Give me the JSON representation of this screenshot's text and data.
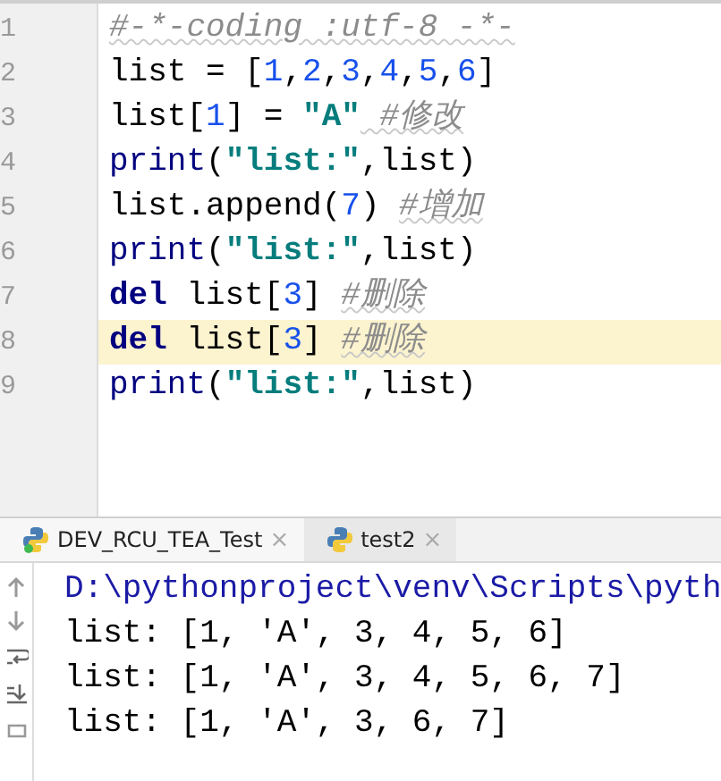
{
  "editor": {
    "lines": [
      {
        "number": "1",
        "current": false,
        "tokens": [
          {
            "kind": "comment",
            "text": "#-*-coding :utf-8 -*-"
          }
        ]
      },
      {
        "number": "2",
        "current": false,
        "tokens": [
          {
            "kind": "plain",
            "text": "list = ["
          },
          {
            "kind": "number",
            "text": "1"
          },
          {
            "kind": "plain",
            "text": ","
          },
          {
            "kind": "number",
            "text": "2"
          },
          {
            "kind": "plain",
            "text": ","
          },
          {
            "kind": "number",
            "text": "3"
          },
          {
            "kind": "plain",
            "text": ","
          },
          {
            "kind": "number",
            "text": "4"
          },
          {
            "kind": "plain",
            "text": ","
          },
          {
            "kind": "number",
            "text": "5"
          },
          {
            "kind": "plain",
            "text": ","
          },
          {
            "kind": "number",
            "text": "6"
          },
          {
            "kind": "plain",
            "text": "]"
          }
        ]
      },
      {
        "number": "3",
        "current": false,
        "tokens": [
          {
            "kind": "plain",
            "text": "list["
          },
          {
            "kind": "number",
            "text": "1"
          },
          {
            "kind": "plain",
            "text": "] = "
          },
          {
            "kind": "string",
            "text": "\"A\""
          },
          {
            "kind": "comment",
            "text": " #修改"
          }
        ]
      },
      {
        "number": "4",
        "current": false,
        "tokens": [
          {
            "kind": "builtin",
            "text": "print"
          },
          {
            "kind": "plain",
            "text": "("
          },
          {
            "kind": "string",
            "text": "\"list:\""
          },
          {
            "kind": "plain",
            "text": ",list)"
          }
        ]
      },
      {
        "number": "5",
        "current": false,
        "tokens": [
          {
            "kind": "plain",
            "text": "list.append("
          },
          {
            "kind": "number",
            "text": "7"
          },
          {
            "kind": "plain",
            "text": ") "
          },
          {
            "kind": "comment",
            "text": "#增加"
          }
        ]
      },
      {
        "number": "6",
        "current": false,
        "tokens": [
          {
            "kind": "builtin",
            "text": "print"
          },
          {
            "kind": "plain",
            "text": "("
          },
          {
            "kind": "string",
            "text": "\"list:\""
          },
          {
            "kind": "plain",
            "text": ",list)"
          }
        ]
      },
      {
        "number": "7",
        "current": false,
        "tokens": [
          {
            "kind": "keyword",
            "text": "del"
          },
          {
            "kind": "plain",
            "text": " list["
          },
          {
            "kind": "number",
            "text": "3"
          },
          {
            "kind": "plain",
            "text": "] "
          },
          {
            "kind": "comment",
            "text": "#删除"
          }
        ]
      },
      {
        "number": "8",
        "current": true,
        "tokens": [
          {
            "kind": "keyword",
            "text": "del"
          },
          {
            "kind": "plain",
            "text": " list["
          },
          {
            "kind": "number",
            "text": "3"
          },
          {
            "kind": "plain",
            "text": "] "
          },
          {
            "kind": "comment",
            "text": "#删除"
          }
        ]
      },
      {
        "number": "9",
        "current": false,
        "tokens": [
          {
            "kind": "builtin",
            "text": "print"
          },
          {
            "kind": "plain",
            "text": "("
          },
          {
            "kind": "string",
            "text": "\"list:\""
          },
          {
            "kind": "plain",
            "text": ",list)"
          }
        ]
      }
    ]
  },
  "run_tabs": [
    {
      "label": "DEV_RCU_TEA_Test",
      "selected": true,
      "running": true,
      "close": "×"
    },
    {
      "label": "test2",
      "selected": false,
      "running": false,
      "close": "×"
    }
  ],
  "console": {
    "lines": [
      {
        "kind": "command",
        "text": "D:\\pythonproject\\venv\\Scripts\\pyth"
      },
      {
        "kind": "output",
        "text": "list: [1, 'A', 3, 4, 5, 6]"
      },
      {
        "kind": "output",
        "text": "list: [1, 'A', 3, 4, 5, 6, 7]"
      },
      {
        "kind": "output",
        "text": "list: [1, 'A', 3, 6, 7]"
      }
    ]
  }
}
